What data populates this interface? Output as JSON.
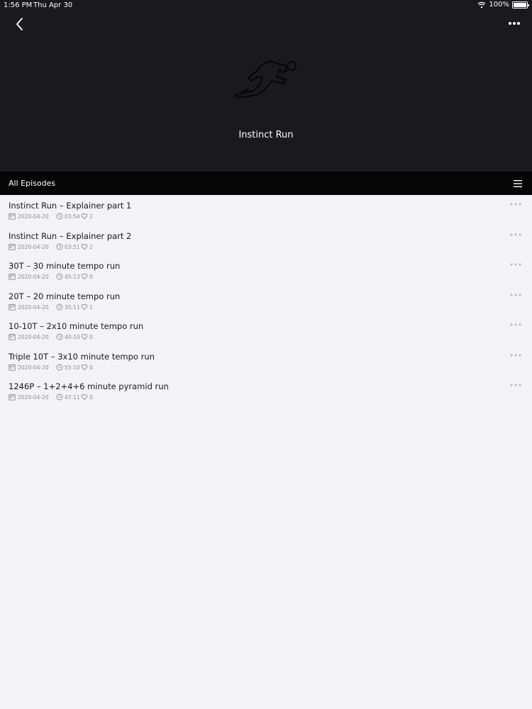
{
  "status_bar": {
    "time": "1:56 PM",
    "date": "Thu Apr 30",
    "battery": "100%",
    "icons": [
      "wifi-icon",
      "battery-icon"
    ]
  },
  "header": {
    "title": "Instinct Run",
    "artwork_icon": "runner-icon",
    "back_icon": "chevron-left-icon",
    "more_icon": "ellipsis-icon"
  },
  "section": {
    "title": "All Episodes",
    "menu_icon": "list-icon"
  },
  "episodes": [
    {
      "title": "Instinct Run – Explainer part 1",
      "date": "2020-04-20",
      "duration": "03:54",
      "likes": "2"
    },
    {
      "title": "Instinct Run – Explainer part 2",
      "date": "2020-04-20",
      "duration": "03:51",
      "likes": "2"
    },
    {
      "title": "30T – 30 minute tempo run",
      "date": "2020-04-20",
      "duration": "45:13",
      "likes": "0"
    },
    {
      "title": "20T – 20 minute tempo run",
      "date": "2020-04-20",
      "duration": "35:11",
      "likes": "1"
    },
    {
      "title": "10-10T – 2x10 minute tempo run",
      "date": "2020-04-20",
      "duration": "40:10",
      "likes": "0"
    },
    {
      "title": "Triple 10T – 3x10 minute tempo run",
      "date": "2020-04-20",
      "duration": "55:10",
      "likes": "0"
    },
    {
      "title": "1246P – 1+2+4+6 minute pyramid run",
      "date": "2020-04-20",
      "duration": "47:11",
      "likes": "0"
    }
  ],
  "colors": {
    "header_bg": "#1a191c",
    "section_bg": "#050505",
    "page_bg": "#f3f2f7",
    "meta_text": "#8c8c8c"
  }
}
